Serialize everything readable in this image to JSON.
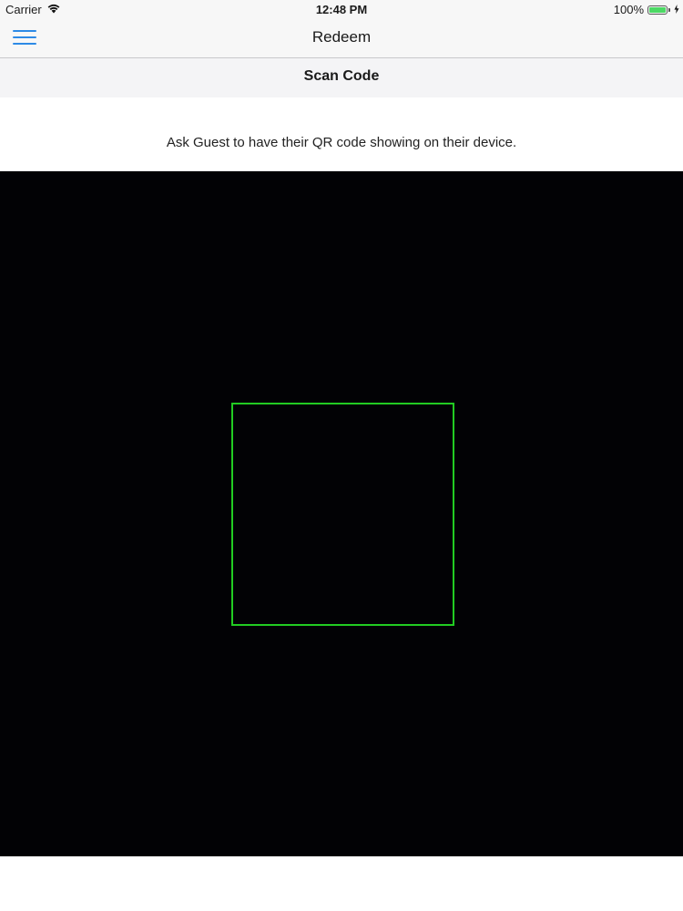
{
  "status_bar": {
    "carrier": "Carrier",
    "time": "12:48 PM",
    "battery_percent": "100%",
    "battery_level": 1.0,
    "wifi_icon": "wifi-icon",
    "battery_icon": "battery-icon",
    "charging_icon": "charging-bolt-icon"
  },
  "nav": {
    "title": "Redeem",
    "menu_icon": "hamburger-menu-icon",
    "accent_color": "#2d8ae6"
  },
  "sub_header": {
    "title": "Scan Code"
  },
  "instruction": {
    "text": "Ask Guest to have their QR code showing on their device."
  },
  "scanner": {
    "frame_color": "#22cc22",
    "background_color": "#020205"
  }
}
